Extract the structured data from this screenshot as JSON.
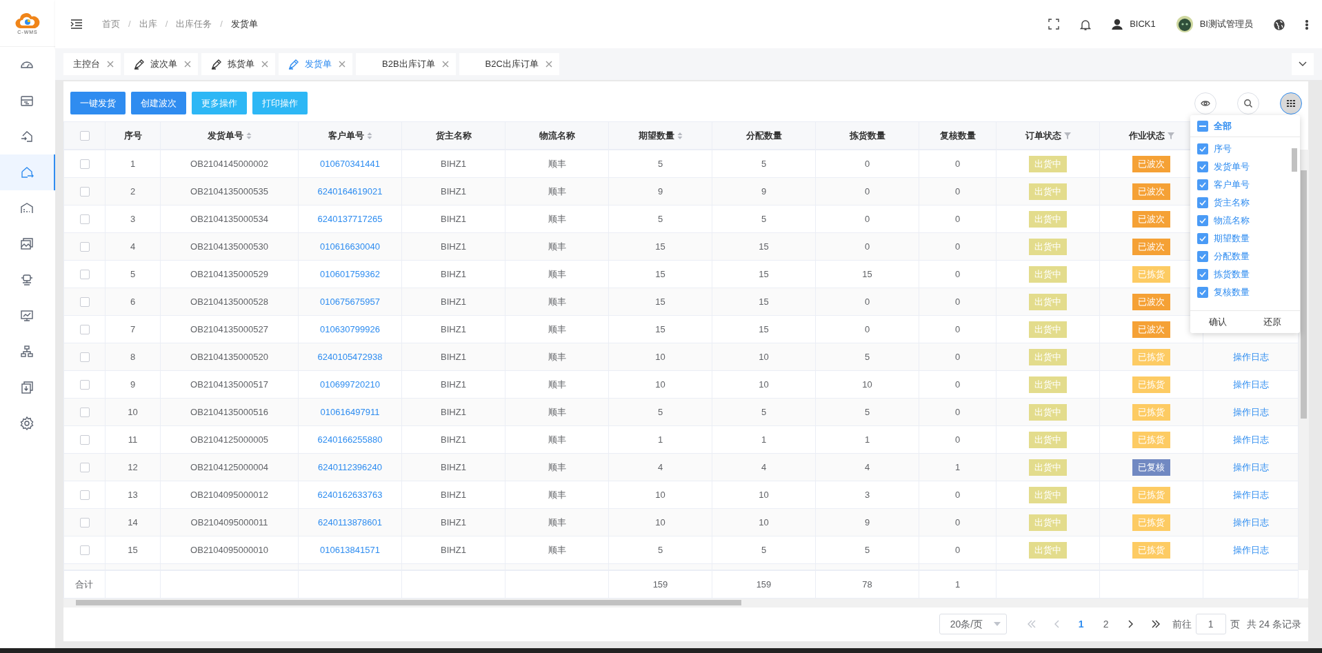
{
  "logo": {
    "text": "C-WMS"
  },
  "sidebar": {
    "items": [
      {
        "selected": false
      },
      {
        "selected": false
      },
      {
        "selected": false
      },
      {
        "selected": true
      },
      {
        "selected": false
      },
      {
        "selected": false
      },
      {
        "selected": false
      },
      {
        "selected": false
      },
      {
        "selected": false
      },
      {
        "selected": false
      },
      {
        "selected": false
      }
    ]
  },
  "breadcrumb": {
    "separator": "/",
    "items": [
      "首页",
      "出库",
      "出库任务",
      "发货单"
    ]
  },
  "header": {
    "user": "BICK1",
    "account": "BI测试管理员"
  },
  "tabs": [
    {
      "label": "主控台",
      "kind": "plain",
      "selected": false
    },
    {
      "label": "波次单",
      "kind": "icon",
      "selected": false
    },
    {
      "label": "拣货单",
      "kind": "icon",
      "selected": false
    },
    {
      "label": "发货单",
      "kind": "icon",
      "selected": true
    },
    {
      "label": "B2B出库订单",
      "kind": "indented",
      "selected": false
    },
    {
      "label": "B2C出库订单",
      "kind": "indented",
      "selected": false
    }
  ],
  "actions": [
    {
      "label": "一键发货",
      "kind": "primary"
    },
    {
      "label": "创建波次",
      "kind": "primary"
    },
    {
      "label": "更多操作",
      "kind": "info"
    },
    {
      "label": "打印操作",
      "kind": "info"
    }
  ],
  "tools": [
    {
      "kind": "eye",
      "selected": false
    },
    {
      "kind": "search",
      "selected": false
    },
    {
      "kind": "grid",
      "selected": true
    }
  ],
  "table": {
    "header_checkbox": {
      "checked": false
    },
    "columns": [
      {
        "label": "序号",
        "kind": "plain"
      },
      {
        "label": "发货单号",
        "kind": "sort"
      },
      {
        "label": "客户单号",
        "kind": "sort"
      },
      {
        "label": "货主名称",
        "kind": "plain"
      },
      {
        "label": "物流名称",
        "kind": "plain"
      },
      {
        "label": "期望数量",
        "kind": "sort"
      },
      {
        "label": "分配数量",
        "kind": "plain"
      },
      {
        "label": "拣货数量",
        "kind": "plain"
      },
      {
        "label": "复核数量",
        "kind": "plain"
      },
      {
        "label": "订单状态",
        "kind": "filter"
      },
      {
        "label": "作业状态",
        "kind": "filter"
      }
    ],
    "rows": [
      {
        "checked": false,
        "cells": [
          "1",
          "OB2104145000002",
          "010670341441",
          "BIHZ1",
          "顺丰",
          "5",
          "5",
          "0",
          "0"
        ],
        "order_status": {
          "text": "出货中",
          "color": "#e3dc8c"
        },
        "work_status": {
          "text": "已波次",
          "color": "#f5a135"
        }
      },
      {
        "checked": false,
        "cells": [
          "2",
          "OB2104135000535",
          "6240164619021",
          "BIHZ1",
          "顺丰",
          "9",
          "9",
          "0",
          "0"
        ],
        "order_status": {
          "text": "出货中",
          "color": "#e3dc8c"
        },
        "work_status": {
          "text": "已波次",
          "color": "#f5a135"
        }
      },
      {
        "checked": false,
        "cells": [
          "3",
          "OB2104135000534",
          "6240137717265",
          "BIHZ1",
          "顺丰",
          "5",
          "5",
          "0",
          "0"
        ],
        "order_status": {
          "text": "出货中",
          "color": "#e3dc8c"
        },
        "work_status": {
          "text": "已波次",
          "color": "#f5a135"
        }
      },
      {
        "checked": false,
        "cells": [
          "4",
          "OB2104135000530",
          "010616630040",
          "BIHZ1",
          "顺丰",
          "15",
          "15",
          "0",
          "0"
        ],
        "order_status": {
          "text": "出货中",
          "color": "#e3dc8c"
        },
        "work_status": {
          "text": "已波次",
          "color": "#f5a135"
        }
      },
      {
        "checked": false,
        "cells": [
          "5",
          "OB2104135000529",
          "010601759362",
          "BIHZ1",
          "顺丰",
          "15",
          "15",
          "15",
          "0"
        ],
        "order_status": {
          "text": "出货中",
          "color": "#e3dc8c"
        },
        "work_status": {
          "text": "已拣货",
          "color": "#fdcb63"
        }
      },
      {
        "checked": false,
        "cells": [
          "6",
          "OB2104135000528",
          "010675675957",
          "BIHZ1",
          "顺丰",
          "15",
          "15",
          "0",
          "0"
        ],
        "order_status": {
          "text": "出货中",
          "color": "#e3dc8c"
        },
        "work_status": {
          "text": "已波次",
          "color": "#f5a135"
        }
      },
      {
        "checked": false,
        "cells": [
          "7",
          "OB2104135000527",
          "010630799926",
          "BIHZ1",
          "顺丰",
          "15",
          "15",
          "0",
          "0"
        ],
        "order_status": {
          "text": "出货中",
          "color": "#e3dc8c"
        },
        "work_status": {
          "text": "已波次",
          "color": "#f5a135"
        }
      },
      {
        "checked": false,
        "cells": [
          "8",
          "OB2104135000520",
          "6240105472938",
          "BIHZ1",
          "顺丰",
          "10",
          "10",
          "5",
          "0"
        ],
        "order_status": {
          "text": "出货中",
          "color": "#e3dc8c"
        },
        "work_status": {
          "text": "已拣货",
          "color": "#fdcb63"
        },
        "action": "操作日志"
      },
      {
        "checked": false,
        "cells": [
          "9",
          "OB2104135000517",
          "010699720210",
          "BIHZ1",
          "顺丰",
          "10",
          "10",
          "10",
          "0"
        ],
        "order_status": {
          "text": "出货中",
          "color": "#e3dc8c"
        },
        "work_status": {
          "text": "已拣货",
          "color": "#fdcb63"
        },
        "action": "操作日志"
      },
      {
        "checked": false,
        "cells": [
          "10",
          "OB2104135000516",
          "010616497911",
          "BIHZ1",
          "顺丰",
          "5",
          "5",
          "5",
          "0"
        ],
        "order_status": {
          "text": "出货中",
          "color": "#e3dc8c"
        },
        "work_status": {
          "text": "已拣货",
          "color": "#fdcb63"
        },
        "action": "操作日志"
      },
      {
        "checked": false,
        "cells": [
          "11",
          "OB2104125000005",
          "6240166255880",
          "BIHZ1",
          "顺丰",
          "1",
          "1",
          "1",
          "0"
        ],
        "order_status": {
          "text": "出货中",
          "color": "#e3dc8c"
        },
        "work_status": {
          "text": "已拣货",
          "color": "#fdcb63"
        },
        "action": "操作日志"
      },
      {
        "checked": false,
        "cells": [
          "12",
          "OB2104125000004",
          "6240112396240",
          "BIHZ1",
          "顺丰",
          "4",
          "4",
          "4",
          "1"
        ],
        "order_status": {
          "text": "出货中",
          "color": "#e3dc8c"
        },
        "work_status": {
          "text": "已复核",
          "color": "#7189c2"
        },
        "action": "操作日志"
      },
      {
        "checked": false,
        "cells": [
          "13",
          "OB2104095000012",
          "6240162633763",
          "BIHZ1",
          "顺丰",
          "10",
          "10",
          "3",
          "0"
        ],
        "order_status": {
          "text": "出货中",
          "color": "#e3dc8c"
        },
        "work_status": {
          "text": "已拣货",
          "color": "#fdcb63"
        },
        "action": "操作日志"
      },
      {
        "checked": false,
        "cells": [
          "14",
          "OB2104095000011",
          "6240113878601",
          "BIHZ1",
          "顺丰",
          "10",
          "10",
          "9",
          "0"
        ],
        "order_status": {
          "text": "出货中",
          "color": "#e3dc8c"
        },
        "work_status": {
          "text": "已拣货",
          "color": "#fdcb63"
        },
        "action": "操作日志"
      },
      {
        "checked": false,
        "cells": [
          "15",
          "OB2104095000010",
          "010613841571",
          "BIHZ1",
          "顺丰",
          "5",
          "5",
          "5",
          "0"
        ],
        "order_status": {
          "text": "出货中",
          "color": "#e3dc8c"
        },
        "work_status": {
          "text": "已拣货",
          "color": "#fdcb63"
        },
        "action": "操作日志"
      }
    ],
    "footer": {
      "label": "合计",
      "totals": [
        "159",
        "159",
        "78",
        "1"
      ]
    }
  },
  "column_settings": {
    "all": {
      "label": "全部",
      "indeterminate": true
    },
    "items": [
      {
        "label": "序号",
        "checked": true
      },
      {
        "label": "发货单号",
        "checked": true
      },
      {
        "label": "客户单号",
        "checked": true
      },
      {
        "label": "货主名称",
        "checked": true
      },
      {
        "label": "物流名称",
        "checked": true
      },
      {
        "label": "期望数量",
        "checked": true
      },
      {
        "label": "分配数量",
        "checked": true
      },
      {
        "label": "拣货数量",
        "checked": true
      },
      {
        "label": "复核数量",
        "checked": true
      }
    ],
    "buttons": [
      "确认",
      "还原"
    ]
  },
  "pagination": {
    "page_size": "20条/页",
    "pages": [
      {
        "label": "1",
        "selected": true
      },
      {
        "label": "2",
        "selected": false
      }
    ],
    "goto_label": "前往",
    "goto_value": "1",
    "goto_unit": "页",
    "total": "共 24 条记录"
  }
}
